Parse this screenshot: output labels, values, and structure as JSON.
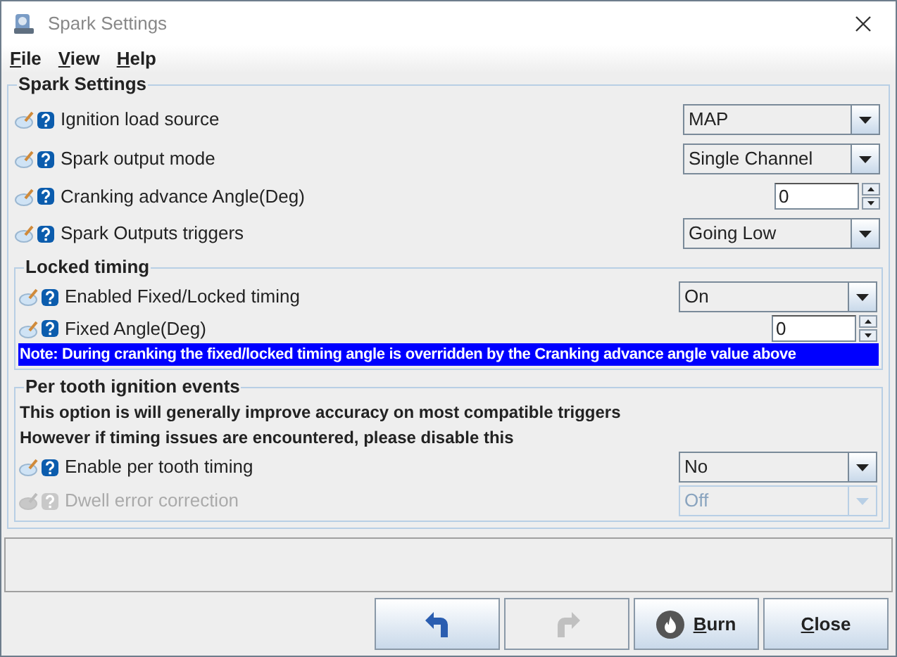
{
  "window": {
    "title": "Spark Settings"
  },
  "menu": [
    "File",
    "View",
    "Help"
  ],
  "groups": [
    {
      "title": "Spark Settings",
      "rows": [
        {
          "kind": "combo",
          "label": "Ignition load source",
          "value": "MAP",
          "disabled": false
        },
        {
          "kind": "combo",
          "label": "Spark output mode",
          "value": "Single Channel",
          "disabled": false
        },
        {
          "kind": "spinner",
          "label": "Cranking advance Angle(Deg)",
          "value": "0",
          "disabled": false
        },
        {
          "kind": "combo",
          "label": "Spark Outputs triggers",
          "value": "Going Low",
          "disabled": false
        }
      ],
      "subgroups": [
        {
          "title": "Locked timing",
          "rows": [
            {
              "kind": "combo",
              "label": "Enabled Fixed/Locked timing",
              "value": "On",
              "disabled": false
            },
            {
              "kind": "spinner",
              "label": "Fixed Angle(Deg)",
              "value": "0",
              "disabled": false
            },
            {
              "kind": "note",
              "label": "Note: During cranking the fixed/locked timing angle is overridden by the Cranking advance angle value above"
            }
          ]
        },
        {
          "title": "Per tooth ignition events",
          "notes": [
            "This option is will generally improve accuracy on most compatible triggers",
            "However if timing issues are encountered, please disable this"
          ],
          "rows": [
            {
              "kind": "combo",
              "label": "Enable per tooth timing",
              "value": "No",
              "disabled": false
            },
            {
              "kind": "combo",
              "label": "Dwell error correction",
              "value": "Off",
              "disabled": true
            }
          ]
        }
      ]
    }
  ],
  "buttons": [
    {
      "kind": "undo",
      "disabled": false
    },
    {
      "kind": "redo",
      "disabled": true
    },
    {
      "kind": "burn",
      "label": "Burn",
      "disabled": false
    },
    {
      "kind": "close",
      "label": "Close",
      "disabled": false
    }
  ]
}
